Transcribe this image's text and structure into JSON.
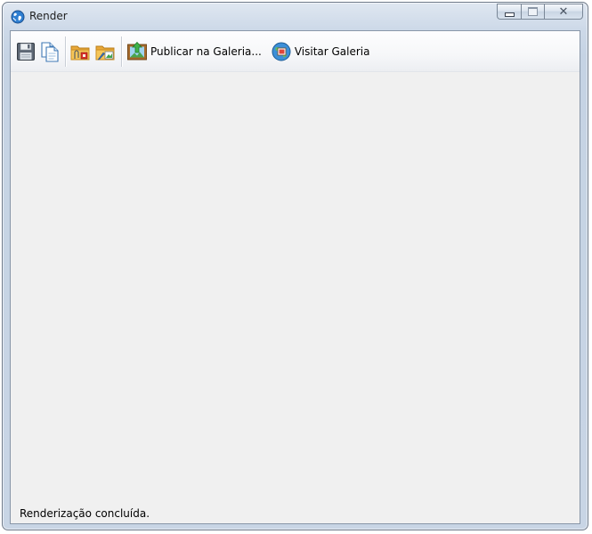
{
  "window": {
    "title": "Render",
    "app_icon": "globe-icon"
  },
  "caption_buttons": {
    "minimize_icon": "minimize-icon",
    "maximize_icon": "maximize-icon",
    "close_glyph": "✕"
  },
  "toolbar": {
    "items": [
      {
        "icon": "save-icon"
      },
      {
        "icon": "copy-document-icon"
      },
      {
        "icon": "folder-attach-icon"
      },
      {
        "icon": "folder-image-icon"
      },
      {
        "icon": "publish-gallery-icon",
        "label": "Publicar na Galeria..."
      },
      {
        "icon": "visit-gallery-icon",
        "label": "Visitar Galeria"
      }
    ]
  },
  "status_bar": {
    "text": "Renderização concluída."
  }
}
